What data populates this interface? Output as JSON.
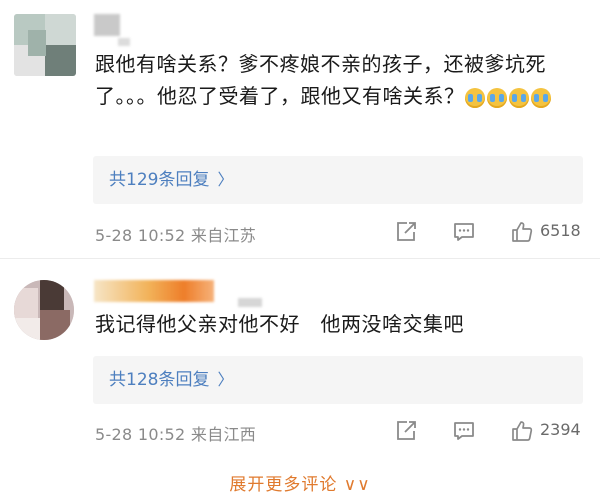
{
  "comments": [
    {
      "text": "跟他有啥关系？爹不疼娘不亲的孩子，还被爹坑死了。。。他忍了受着了，跟他又有啥关系？",
      "replies_label": "共129条回复",
      "date": "5-28 10:52",
      "location": "来自江苏",
      "likes": "6518"
    },
    {
      "text": "我记得他父亲对他不好　他两没啥交集吧",
      "replies_label": "共128条回复",
      "date": "5-28 10:52",
      "location": "来自江西",
      "likes": "2394"
    }
  ],
  "footer": {
    "expand_label": "展开更多评论 ∨∨"
  },
  "colors": {
    "link_blue": "#4d7fbf",
    "meta_gray": "#8a8a8a",
    "reply_bg": "#f5f5f5",
    "expand_orange": "#e07a2e"
  },
  "icons": {
    "share": "share-icon",
    "comment": "comment-icon",
    "like": "thumbs-up-icon",
    "chevron": "chevron-right-icon"
  }
}
